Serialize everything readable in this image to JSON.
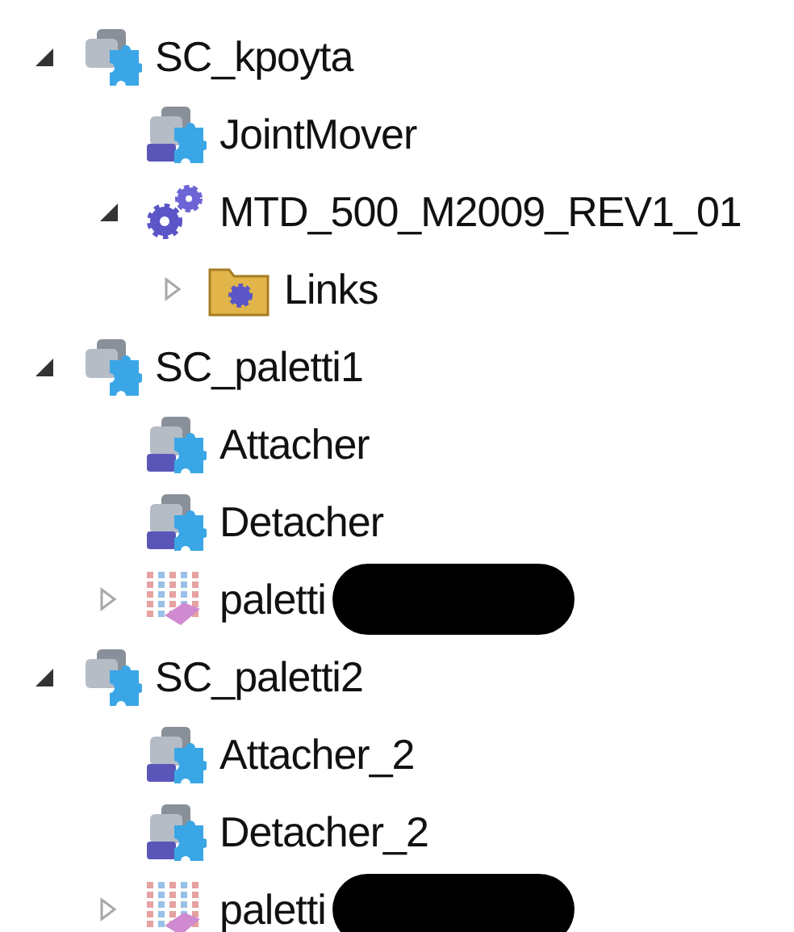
{
  "tree": [
    {
      "kind": "station",
      "label": "SC_kpoyta",
      "expanded": true,
      "children": [
        {
          "kind": "component",
          "label": "JointMover"
        },
        {
          "kind": "mechanism",
          "label": "MTD_500_M2009_REV1_01",
          "expanded": true,
          "children": [
            {
              "kind": "folder",
              "label": "Links",
              "expanded": false
            }
          ]
        }
      ]
    },
    {
      "kind": "station",
      "label": "SC_paletti1",
      "expanded": true,
      "children": [
        {
          "kind": "component",
          "label": "Attacher"
        },
        {
          "kind": "component",
          "label": "Detacher"
        },
        {
          "kind": "palette",
          "label": "paletti",
          "expanded": false,
          "redacted": true
        }
      ]
    },
    {
      "kind": "station",
      "label": "SC_paletti2",
      "expanded": true,
      "children": [
        {
          "kind": "component",
          "label": "Attacher_2"
        },
        {
          "kind": "component",
          "label": "Detacher_2"
        },
        {
          "kind": "palette",
          "label": "paletti",
          "expanded": false,
          "redacted": true
        }
      ]
    }
  ]
}
